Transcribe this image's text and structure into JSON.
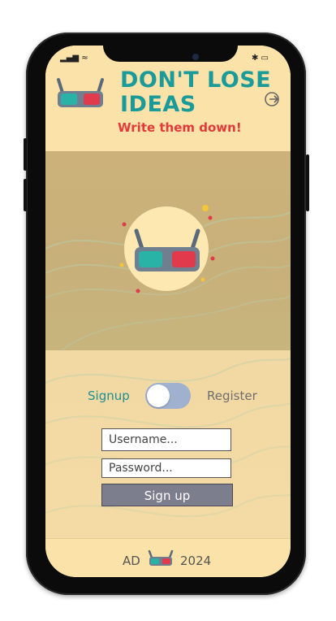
{
  "header": {
    "title": "DON'T LOSE IDEAS",
    "subtitle": "Write them down!"
  },
  "auth": {
    "toggle_left_label": "Signup",
    "toggle_right_label": "Register",
    "username_placeholder": "Username...",
    "password_placeholder": "Password...",
    "submit_label": "Sign up"
  },
  "footer": {
    "left_text": "AD",
    "right_text": "2024"
  },
  "colors": {
    "accent_teal": "#1b9a9a",
    "accent_red": "#e23a3a",
    "background": "#fbe2a8",
    "button": "#7d7e8d",
    "toggle": "#9fb1cf"
  },
  "icons": {
    "logo": "3d-glasses-icon",
    "logout": "logout-icon",
    "hero": "3d-glasses-icon",
    "footer": "3d-glasses-icon"
  }
}
